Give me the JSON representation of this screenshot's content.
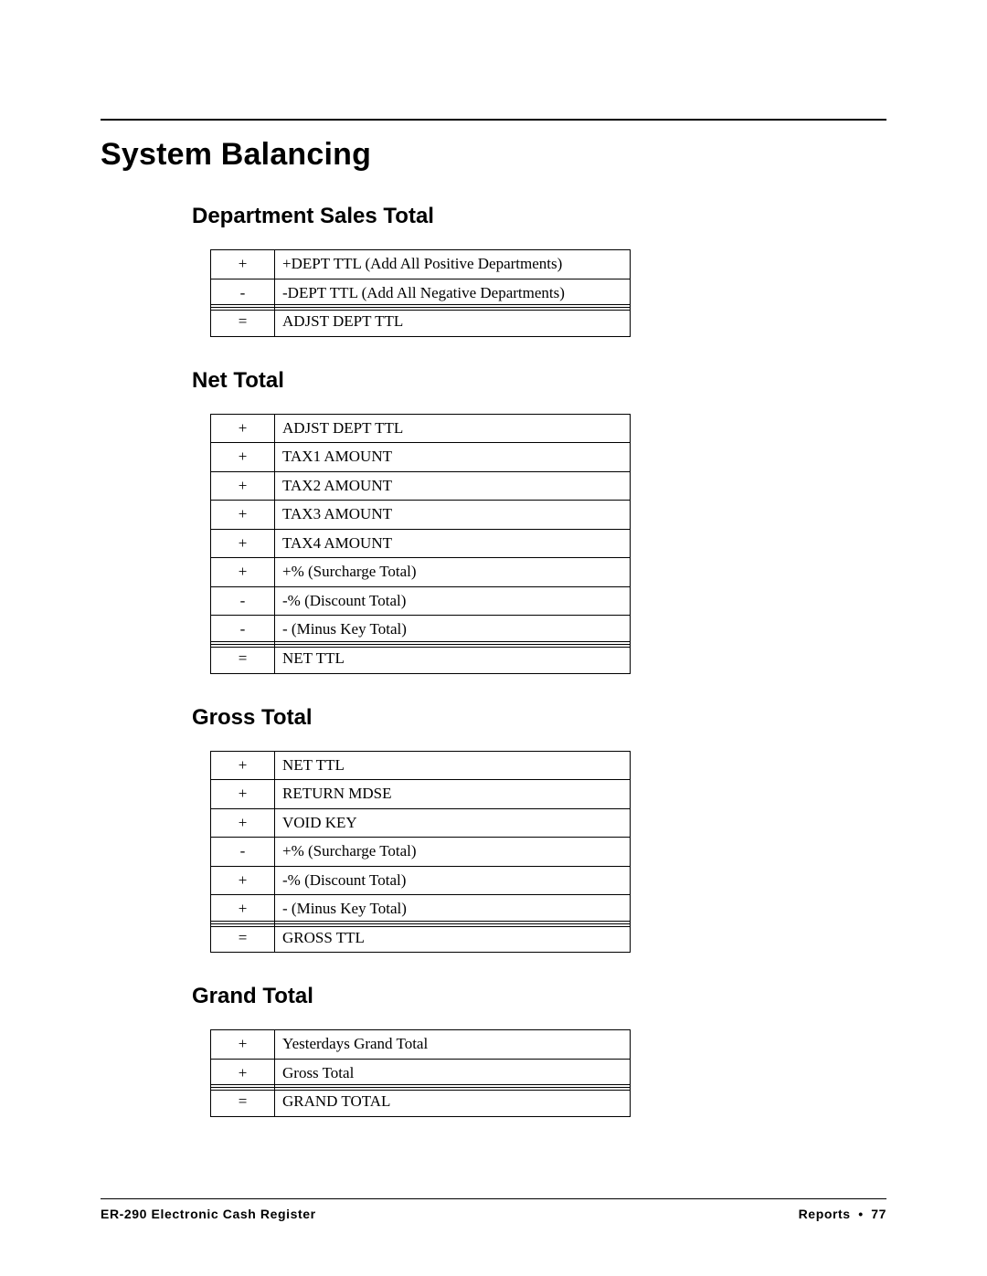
{
  "title": "System Balancing",
  "sections": [
    {
      "heading": "Department Sales Total",
      "rows": [
        {
          "op": "+",
          "label": "+DEPT TTL (Add All Positive Departments)"
        },
        {
          "op": "-",
          "label": "-DEPT TTL (Add All Negative Departments)"
        }
      ],
      "result": {
        "op": "=",
        "label": "ADJST DEPT TTL"
      }
    },
    {
      "heading": "Net Total",
      "rows": [
        {
          "op": "+",
          "label": "ADJST DEPT TTL"
        },
        {
          "op": "+",
          "label": "TAX1 AMOUNT"
        },
        {
          "op": "+",
          "label": "TAX2 AMOUNT"
        },
        {
          "op": "+",
          "label": "TAX3 AMOUNT"
        },
        {
          "op": "+",
          "label": "TAX4 AMOUNT"
        },
        {
          "op": "+",
          "label": "+% (Surcharge Total)"
        },
        {
          "op": "-",
          "label": "-% (Discount Total)"
        },
        {
          "op": "-",
          "label": "- (Minus Key Total)"
        }
      ],
      "result": {
        "op": "=",
        "label": "NET TTL"
      }
    },
    {
      "heading": "Gross Total",
      "rows": [
        {
          "op": "+",
          "label": "NET TTL"
        },
        {
          "op": "+",
          "label": "RETURN MDSE"
        },
        {
          "op": "+",
          "label": "VOID KEY"
        },
        {
          "op": "-",
          "label": "+% (Surcharge Total)"
        },
        {
          "op": "+",
          "label": "-% (Discount Total)"
        },
        {
          "op": "+",
          "label": "- (Minus Key Total)"
        }
      ],
      "result": {
        "op": "=",
        "label": "GROSS TTL"
      }
    },
    {
      "heading": "Grand Total",
      "rows": [
        {
          "op": "+",
          "label": "Yesterdays Grand Total"
        },
        {
          "op": "+",
          "label": "Gross Total"
        }
      ],
      "result": {
        "op": "=",
        "label": "GRAND TOTAL"
      }
    }
  ],
  "footer": {
    "left": "ER-290 Electronic Cash Register",
    "right_section": "Reports",
    "bullet": "•",
    "page": "77"
  }
}
